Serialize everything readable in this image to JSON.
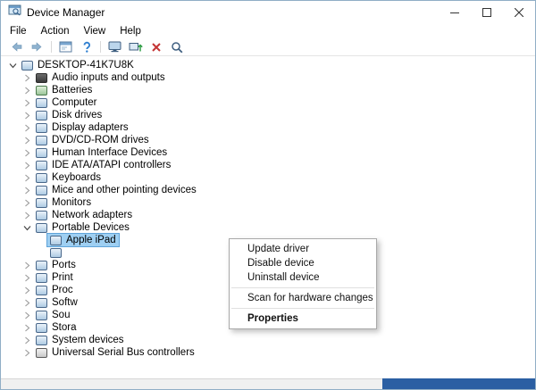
{
  "window": {
    "title": "Device Manager",
    "controls": [
      "minimize-icon",
      "maximize-icon",
      "close-icon"
    ]
  },
  "menubar": {
    "items": [
      "File",
      "Action",
      "View",
      "Help"
    ]
  },
  "toolbar": {
    "icons": [
      "back-arrow-icon",
      "forward-arrow-icon",
      "console-window-icon",
      "help-icon",
      "monitor-icon",
      "update-driver-icon",
      "uninstall-device-icon",
      "scan-hardware-icon"
    ]
  },
  "tree": {
    "items": [
      {
        "label": "DESKTOP-41K7U8K",
        "level": 0,
        "state": "expanded",
        "icon": "computer-icon"
      },
      {
        "label": "Audio inputs and outputs",
        "level": 1,
        "state": "collapsed",
        "icon": "speaker-icon"
      },
      {
        "label": "Batteries",
        "level": 1,
        "state": "collapsed",
        "icon": "battery-icon"
      },
      {
        "label": "Computer",
        "level": 1,
        "state": "collapsed",
        "icon": "computer-icon"
      },
      {
        "label": "Disk drives",
        "level": 1,
        "state": "collapsed",
        "icon": "disk-drive-icon"
      },
      {
        "label": "Display adapters",
        "level": 1,
        "state": "collapsed",
        "icon": "display-adapter-icon"
      },
      {
        "label": "DVD/CD-ROM drives",
        "level": 1,
        "state": "collapsed",
        "icon": "dvd-drive-icon"
      },
      {
        "label": "Human Interface Devices",
        "level": 1,
        "state": "collapsed",
        "icon": "hid-icon"
      },
      {
        "label": "IDE ATA/ATAPI controllers",
        "level": 1,
        "state": "collapsed",
        "icon": "ide-controller-icon"
      },
      {
        "label": "Keyboards",
        "level": 1,
        "state": "collapsed",
        "icon": "keyboard-icon"
      },
      {
        "label": "Mice and other pointing devices",
        "level": 1,
        "state": "collapsed",
        "icon": "mouse-icon"
      },
      {
        "label": "Monitors",
        "level": 1,
        "state": "collapsed",
        "icon": "monitor-icon"
      },
      {
        "label": "Network adapters",
        "level": 1,
        "state": "collapsed",
        "icon": "network-adapter-icon"
      },
      {
        "label": "Portable Devices",
        "level": 1,
        "state": "expanded",
        "icon": "portable-devices-icon"
      },
      {
        "label": "Apple iPad",
        "level": 2,
        "state": "leaf",
        "icon": "tablet-icon",
        "selected": true
      },
      {
        "label": "",
        "level": 2,
        "state": "leaf",
        "icon": "portable-device-icon"
      },
      {
        "label": "Ports",
        "level": 1,
        "state": "collapsed",
        "icon": "ports-icon"
      },
      {
        "label": "Print",
        "level": 1,
        "state": "collapsed",
        "icon": "printer-icon"
      },
      {
        "label": "Proc",
        "level": 1,
        "state": "collapsed",
        "icon": "processor-icon"
      },
      {
        "label": "Softw",
        "level": 1,
        "state": "collapsed",
        "icon": "software-icon"
      },
      {
        "label": "Sou",
        "level": 1,
        "state": "collapsed",
        "icon": "sound-icon"
      },
      {
        "label": "Stora",
        "level": 1,
        "state": "collapsed",
        "icon": "storage-icon"
      },
      {
        "label": "System devices",
        "level": 1,
        "state": "collapsed",
        "icon": "system-devices-icon"
      },
      {
        "label": "Universal Serial Bus controllers",
        "level": 1,
        "state": "collapsed",
        "icon": "usb-icon"
      }
    ]
  },
  "context_menu": {
    "items": [
      {
        "type": "item",
        "label": "Update driver"
      },
      {
        "type": "item",
        "label": "Disable device"
      },
      {
        "type": "item",
        "label": "Uninstall device"
      },
      {
        "type": "separator"
      },
      {
        "type": "item",
        "label": "Scan for hardware changes"
      },
      {
        "type": "separator"
      },
      {
        "type": "item",
        "label": "Properties",
        "bold": true
      }
    ]
  },
  "colors": {
    "selection": "#9ecff2",
    "window_border": "#90aec6",
    "taskbar_fragment": "#2b5fa3"
  }
}
